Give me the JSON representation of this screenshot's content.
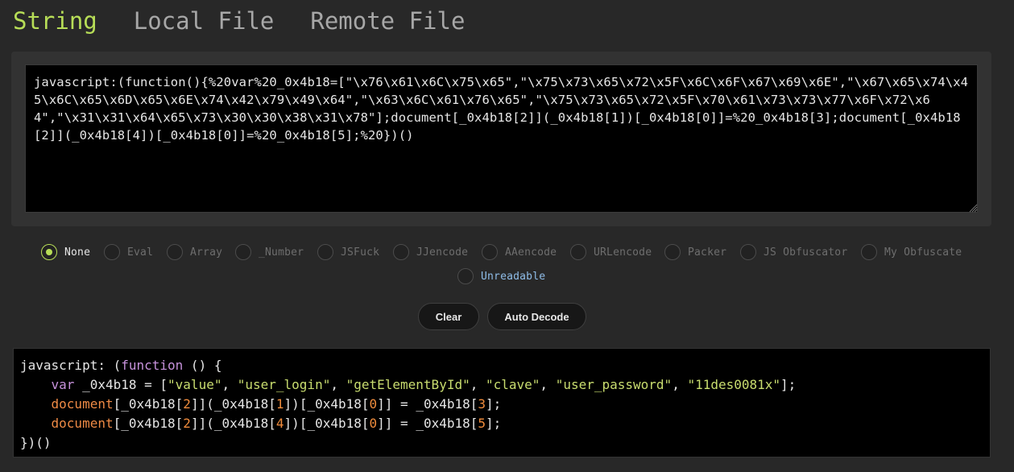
{
  "tabs": [
    {
      "label": "String",
      "active": true
    },
    {
      "label": "Local File",
      "active": false
    },
    {
      "label": "Remote File",
      "active": false
    }
  ],
  "input": {
    "value": "javascript:(function(){%20var%20_0x4b18=[\"\\x76\\x61\\x6C\\x75\\x65\",\"\\x75\\x73\\x65\\x72\\x5F\\x6C\\x6F\\x67\\x69\\x6E\",\"\\x67\\x65\\x74\\x45\\x6C\\x65\\x6D\\x65\\x6E\\x74\\x42\\x79\\x49\\x64\",\"\\x63\\x6C\\x61\\x76\\x65\",\"\\x75\\x73\\x65\\x72\\x5F\\x70\\x61\\x73\\x73\\x77\\x6F\\x72\\x64\",\"\\x31\\x31\\x64\\x65\\x73\\x30\\x30\\x38\\x31\\x78\"];document[_0x4b18[2]](_0x4b18[1])[_0x4b18[0]]=%20_0x4b18[3];document[_0x4b18[2]](_0x4b18[4])[_0x4b18[0]]=%20_0x4b18[5];%20})()"
  },
  "options": {
    "row1": [
      "None",
      "Eval",
      "Array",
      "_Number",
      "JSFuck",
      "JJencode",
      "AAencode",
      "URLencode",
      "Packer",
      "JS Obfuscator",
      "My Obfuscate"
    ],
    "row2": [
      "Unreadable"
    ],
    "selected": "None"
  },
  "buttons": {
    "clear": "Clear",
    "auto_decode": "Auto Decode"
  },
  "output": {
    "line1_prefix": "javascript: (",
    "line1_kw": "function",
    "line1_suffix": " () {",
    "var_kw": "var",
    "var_name": " _0x4b18 = [",
    "strings": [
      "\"value\"",
      "\"user_login\"",
      "\"getElementById\"",
      "\"clave\"",
      "\"user_password\"",
      "\"11des0081x\""
    ],
    "doc": "document",
    "line4_nums": [
      "2",
      "1",
      "0",
      "3"
    ],
    "line5_nums": [
      "2",
      "4",
      "0",
      "5"
    ],
    "close": "})()"
  }
}
